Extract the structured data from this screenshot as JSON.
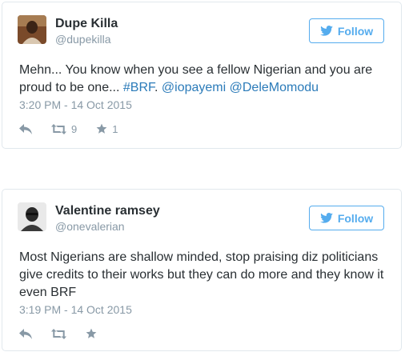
{
  "colors": {
    "accent": "#55acee",
    "link": "#2b7bb9",
    "muted": "#8899a6",
    "text": "#292f33",
    "border": "#e1e8ed"
  },
  "tweets": [
    {
      "user": {
        "name": "Dupe Killa",
        "handle": "@dupekilla"
      },
      "follow_label": "Follow",
      "text": {
        "part1": "Mehn... You know when you see a fellow Nigerian and you are proud to be one... ",
        "hashtag": "#BRF",
        "part2": ". ",
        "mention1": "@iopayemi",
        "part3": " ",
        "mention2": "@DeleMomodu"
      },
      "timestamp": "3:20 PM - 14 Oct 2015",
      "retweets": "9",
      "favorites": "1",
      "icons": [
        "reply-icon",
        "retweet-icon",
        "favorite-icon"
      ]
    },
    {
      "user": {
        "name": "Valentine ramsey",
        "handle": "@onevalerian"
      },
      "follow_label": "Follow",
      "text": "Most Nigerians are shallow minded, stop praising diz politicians give credits to their works but they can do more and they know it even BRF",
      "timestamp": "3:19 PM - 14 Oct 2015",
      "icons": [
        "reply-icon",
        "retweet-icon",
        "favorite-icon"
      ]
    }
  ]
}
